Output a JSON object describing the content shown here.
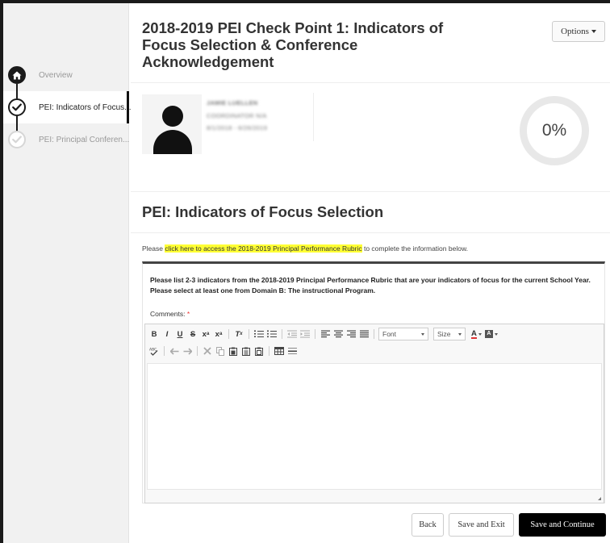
{
  "sidebar": {
    "steps": [
      {
        "label": "Overview",
        "icon": "home-icon",
        "state": "home"
      },
      {
        "label": "PEI: Indicators of Focus...",
        "icon": "check-circle-icon",
        "state": "active"
      },
      {
        "label": "PEI: Principal Conferen...",
        "icon": "check-circle-icon",
        "state": "upcoming"
      }
    ]
  },
  "header": {
    "title": "2018-2019 PEI Check Point 1: Indicators of Focus Selection & Conference Acknowledgement",
    "options_label": "Options"
  },
  "profile": {
    "name": "JAMIE LUELLEN",
    "role": "COORDINATOR N/A",
    "dates": "8/1/2018 - 6/26/2019",
    "progress": "0%"
  },
  "section": {
    "title": "PEI: Indicators of Focus Selection",
    "intro_before": "Please ",
    "intro_link": "click here to access the 2018-2019 Principal Performance Rubric",
    "intro_after": " to complete the information below.",
    "question": "Please list 2-3 indicators from the 2018-2019 Principal Performance Rubric that are your indicators of focus for the current School Year. Please select at least one from Domain B: The instructional Program.",
    "comments_label": "Comments:",
    "required_mark": "*"
  },
  "editor": {
    "font_label": "Font",
    "size_label": "Size",
    "content": ""
  },
  "actions": {
    "back": "Back",
    "save_exit": "Save and Exit",
    "save_continue": "Save and Continue"
  },
  "colors": {
    "highlight": "#ffff33",
    "primary_button": "#000000",
    "frame": "#1a1a1a"
  }
}
